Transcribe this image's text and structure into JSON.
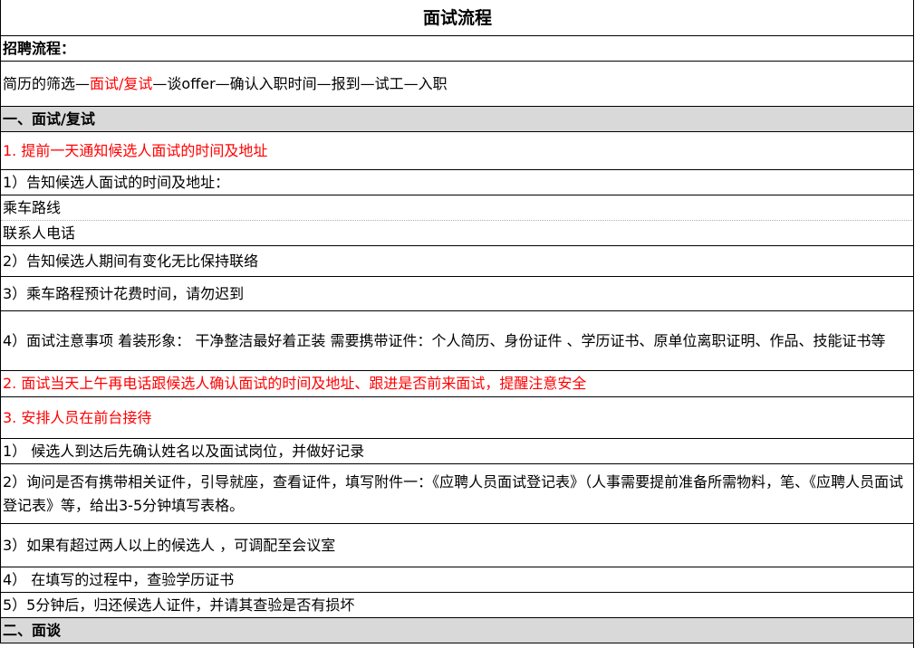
{
  "title": "面试流程",
  "recruitment": {
    "label": "招聘流程：",
    "flow_before": "简历的筛选—",
    "flow_red": "面试/复试",
    "flow_after": "—谈offer—确认入职时间—报到—试工—入职"
  },
  "section1": {
    "header": "一、面试/复试",
    "step1": {
      "title": "1. 提前一天通知候选人面试的时间及地址",
      "items": [
        "1）告知候选人面试的时间及地址：",
        "乘车路线",
        "联系人电话",
        "2）告知候选人期间有变化无比保持联络",
        "3）乘车路程预计花费时间，请勿迟到",
        "4）面试注意事项 着装形象： 干净整洁最好着正装  需要携带证件：个人简历、身份证件 、学历证书、原单位离职证明、作品、技能证书等"
      ]
    },
    "step2": {
      "title": "2. 面试当天上午再电话跟候选人确认面试的时间及地址、跟进是否前来面试，提醒注意安全"
    },
    "step3": {
      "title": "3. 安排人员在前台接待",
      "items": [
        "1） 候选人到达后先确认姓名以及面试岗位，并做好记录",
        "2）询问是否有携带相关证件，引导就座，查看证件，填写附件一：《应聘人员面试登记表》（人事需要提前准备所需物料，笔、《应聘人员面试登记表》等，给出3-5分钟填写表格。",
        "3）如果有超过两人以上的候选人 ，可调配至会议室",
        "4） 在填写的过程中，查验学历证书",
        "5）5分钟后，归还候选人证件，并请其查验是否有损坏"
      ]
    }
  },
  "section2": {
    "header": "二、面谈"
  },
  "colors": {
    "red_text": "#ff0000",
    "header_bg": "#d9d9d9",
    "border": "#000000"
  }
}
